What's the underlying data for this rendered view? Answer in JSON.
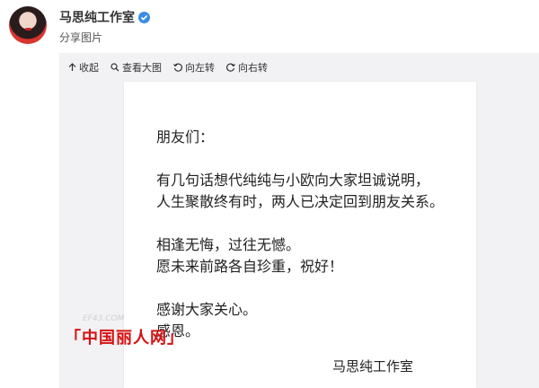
{
  "post": {
    "author": "马思纯工作室",
    "subtitle": "分享图片"
  },
  "toolbar": {
    "collapse": "收起",
    "view_large": "查看大图",
    "rotate_left": "向左转",
    "rotate_right": "向右转"
  },
  "letter": {
    "greeting": "朋友们：",
    "line1": "有几句话想代纯纯与小欧向大家坦诚说明，",
    "line2": "人生聚散终有时，两人已决定回到朋友关系。",
    "line3": "相逢无悔，过往无憾。",
    "line4": "愿未来前路各自珍重，祝好！",
    "line5": "感谢大家关心。",
    "line6": "感恩。",
    "signature": "马思纯工作室"
  },
  "watermark": {
    "brand": "「中国丽人网」",
    "site": "EF43.COM"
  },
  "colors": {
    "verified": "#3a8de0",
    "watermark": "#d51111",
    "panel_bg": "#f2f2f5"
  }
}
